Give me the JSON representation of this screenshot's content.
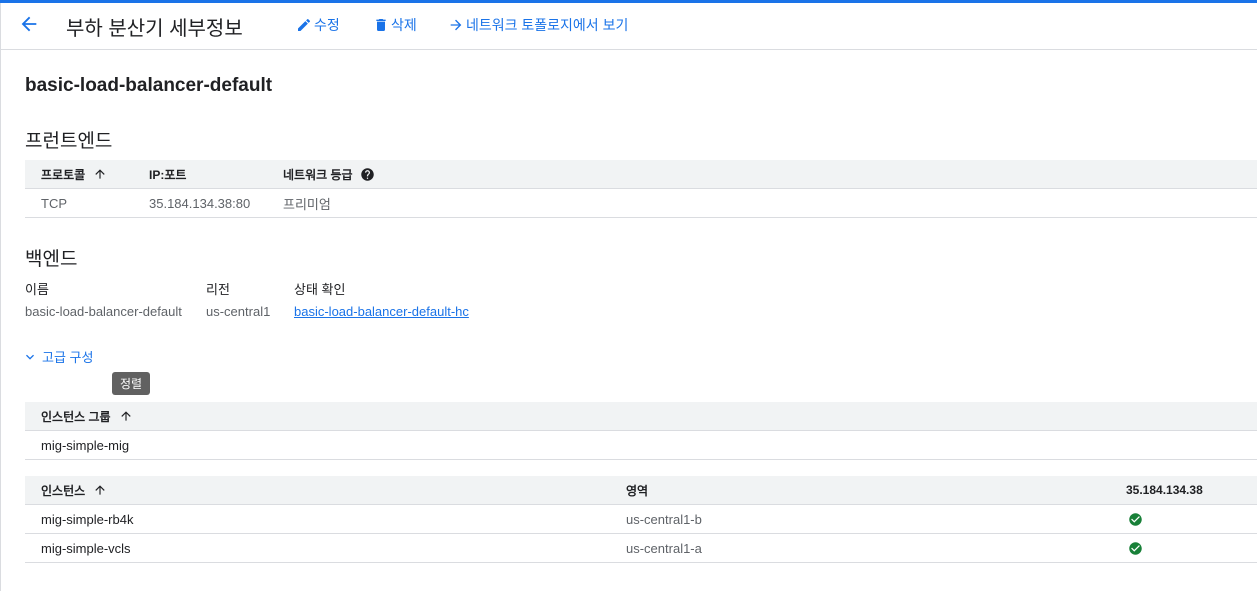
{
  "header": {
    "title": "부하 분산기 세부정보",
    "edit_label": "수정",
    "delete_label": "삭제",
    "topology_label": "네트워크 토폴로지에서 보기"
  },
  "lb_name": "basic-load-balancer-default",
  "frontend": {
    "title": "프런트엔드",
    "columns": {
      "protocol": "프로토콜",
      "ip_port": "IP:포트",
      "network_tier": "네트워크 등급"
    },
    "rows": [
      {
        "protocol": "TCP",
        "ip_port": "35.184.134.38:80",
        "network_tier": "프리미엄"
      }
    ]
  },
  "backend": {
    "title": "백엔드",
    "name_label": "이름",
    "region_label": "리전",
    "health_label": "상태 확인",
    "name_value": "basic-load-balancer-default",
    "region_value": "us-central1",
    "health_value": "basic-load-balancer-default-hc",
    "advanced_label": "고급 구성",
    "tooltip": "정렬"
  },
  "instance_groups": {
    "header": "인스턴스 그룹",
    "rows": [
      "mig-simple-mig"
    ]
  },
  "instances": {
    "columns": {
      "instance": "인스턴스",
      "zone": "영역",
      "ip": "35.184.134.38"
    },
    "rows": [
      {
        "name": "mig-simple-rb4k",
        "zone": "us-central1-b",
        "status": "healthy"
      },
      {
        "name": "mig-simple-vcls",
        "zone": "us-central1-a",
        "status": "healthy"
      }
    ]
  },
  "colors": {
    "accent": "#1a73e8",
    "healthy": "#188038",
    "table_header_bg": "#f1f3f4",
    "tooltip_bg": "#616161"
  },
  "icons": {
    "back": "arrow-left-icon",
    "edit": "pencil-icon",
    "delete": "trash-icon",
    "topology": "arrow-right-icon",
    "sort": "arrow-up-icon",
    "help": "question-circle-icon",
    "expand": "chevron-down-icon",
    "status": "check-circle-icon"
  }
}
